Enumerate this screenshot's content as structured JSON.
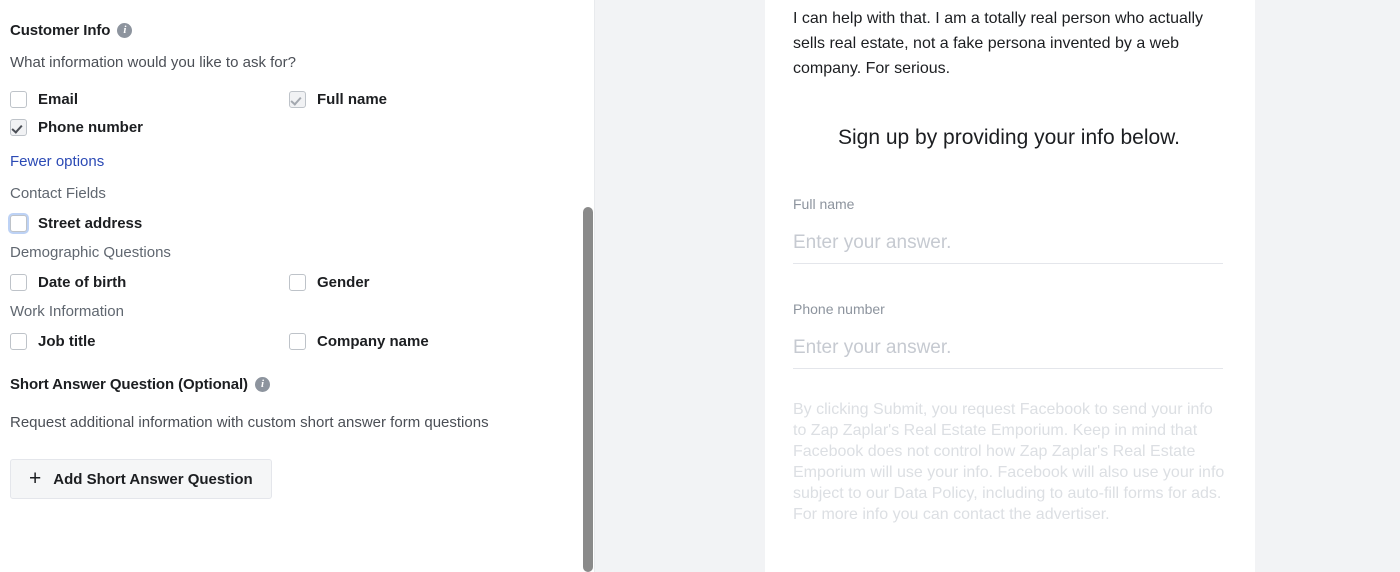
{
  "editor": {
    "customer_info": {
      "title": "Customer Info",
      "info_icon": "info-icon",
      "question": "What information would you like to ask for?",
      "options": [
        {
          "label": "Email",
          "checked": false,
          "disabled": false,
          "focused": false
        },
        {
          "label": "Full name",
          "checked": true,
          "disabled": true,
          "focused": false
        },
        {
          "label": "Phone number",
          "checked": true,
          "disabled": false,
          "focused": false
        }
      ],
      "toggle_link": "Fewer options",
      "groups": [
        {
          "label": "Contact Fields",
          "options": [
            {
              "label": "Street address",
              "checked": false,
              "disabled": false,
              "focused": true
            }
          ]
        },
        {
          "label": "Demographic Questions",
          "options": [
            {
              "label": "Date of birth",
              "checked": false,
              "disabled": false,
              "focused": false
            },
            {
              "label": "Gender",
              "checked": false,
              "disabled": false,
              "focused": false
            }
          ]
        },
        {
          "label": "Work Information",
          "options": [
            {
              "label": "Job title",
              "checked": false,
              "disabled": false,
              "focused": false
            },
            {
              "label": "Company name",
              "checked": false,
              "disabled": false,
              "focused": false
            }
          ]
        }
      ]
    },
    "short_answer": {
      "title": "Short Answer Question (Optional)",
      "info_icon": "info-icon",
      "description": "Request additional information with custom short answer form questions",
      "add_button": "Add Short Answer Question",
      "add_button_icon": "plus-icon"
    }
  },
  "preview": {
    "intro_text": "I can help with that. I am a totally real person who actually sells real estate, not a fake persona invented by a web company. For serious.",
    "heading": "Sign up by providing your info below.",
    "fields": [
      {
        "label": "Full name",
        "placeholder": "Enter your answer.",
        "value": ""
      },
      {
        "label": "Phone number",
        "placeholder": "Enter your answer.",
        "value": ""
      }
    ],
    "legal_text": "By clicking Submit, you request Facebook to send your info to Zap Zaplar's Real Estate Emporium. Keep in mind that Facebook does not control how Zap Zaplar's Real Estate Emporium will use your info. Facebook will also use your info subject to our Data Policy, including to auto-fill forms for ads. For more info you can contact the advertiser."
  },
  "colors": {
    "link": "#2b4ab5",
    "text_primary": "#1c1e21",
    "text_secondary": "#606770",
    "placeholder": "#c6cad1",
    "legal": "#dcdfe3",
    "panel_bg": "#f2f3f5",
    "focus_ring": "#bdd2f5"
  }
}
